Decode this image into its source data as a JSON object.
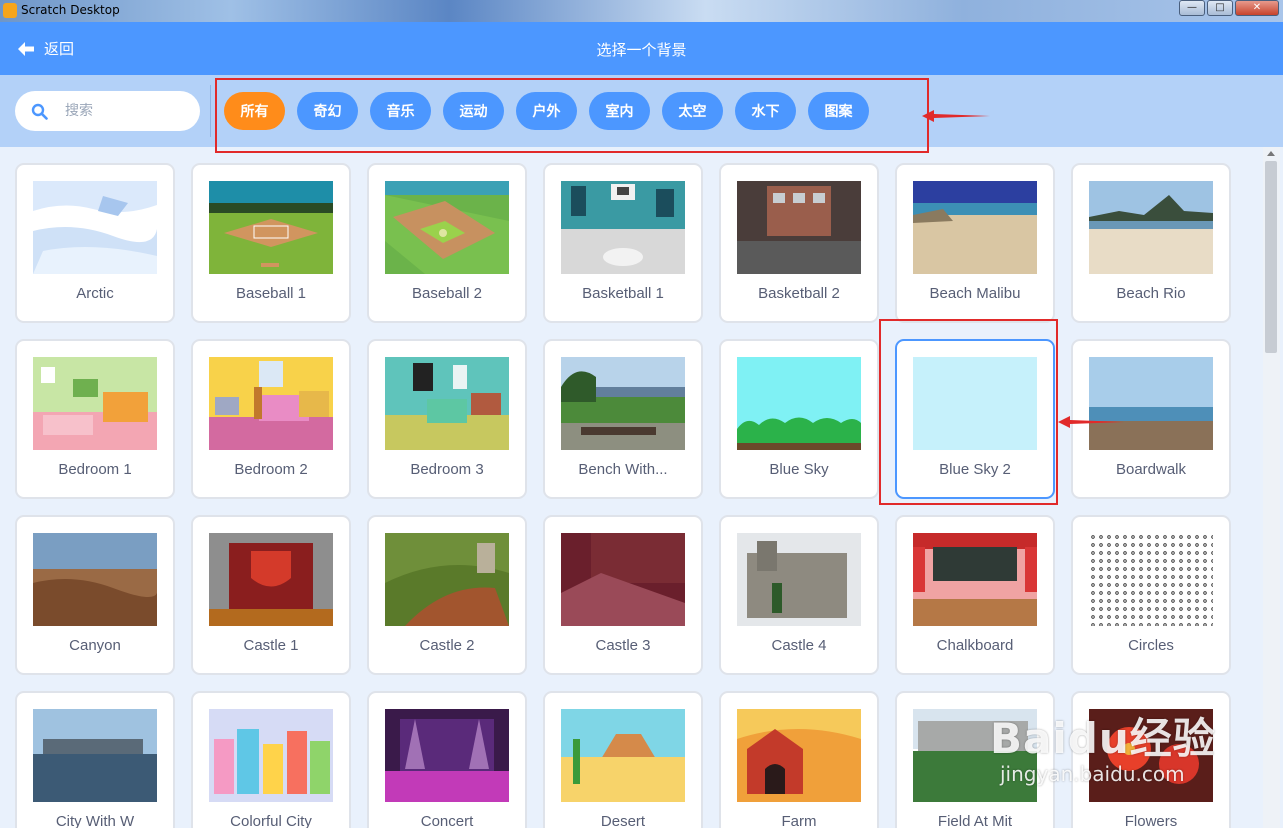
{
  "window": {
    "title": "Scratch Desktop"
  },
  "header": {
    "back_label": "返回",
    "title": "选择一个背景"
  },
  "search": {
    "placeholder": "搜索",
    "value": ""
  },
  "tags": [
    {
      "label": "所有",
      "active": true
    },
    {
      "label": "奇幻"
    },
    {
      "label": "音乐"
    },
    {
      "label": "运动"
    },
    {
      "label": "户外"
    },
    {
      "label": "室内"
    },
    {
      "label": "太空"
    },
    {
      "label": "水下"
    },
    {
      "label": "图案"
    }
  ],
  "backdrops": [
    {
      "name": "Arctic"
    },
    {
      "name": "Baseball 1"
    },
    {
      "name": "Baseball 2"
    },
    {
      "name": "Basketball 1"
    },
    {
      "name": "Basketball 2"
    },
    {
      "name": "Beach Malibu"
    },
    {
      "name": "Beach Rio"
    },
    {
      "name": "Bedroom 1"
    },
    {
      "name": "Bedroom 2"
    },
    {
      "name": "Bedroom 3"
    },
    {
      "name": "Bench With..."
    },
    {
      "name": "Blue Sky"
    },
    {
      "name": "Blue Sky 2",
      "selected": true
    },
    {
      "name": "Boardwalk"
    },
    {
      "name": "Canyon"
    },
    {
      "name": "Castle 1"
    },
    {
      "name": "Castle 2"
    },
    {
      "name": "Castle 3"
    },
    {
      "name": "Castle 4"
    },
    {
      "name": "Chalkboard"
    },
    {
      "name": "Circles"
    },
    {
      "name": "City With W"
    },
    {
      "name": "Colorful City"
    },
    {
      "name": "Concert"
    },
    {
      "name": "Desert"
    },
    {
      "name": "Farm"
    },
    {
      "name": "Field At Mit"
    },
    {
      "name": "Flowers"
    }
  ],
  "watermark": {
    "brand": "Baidu经验",
    "url": "jingyan.baidu.com"
  },
  "colors": {
    "primary": "#4c97ff",
    "active_tag": "#ff8c1a",
    "annotation": "#e12a2a"
  }
}
